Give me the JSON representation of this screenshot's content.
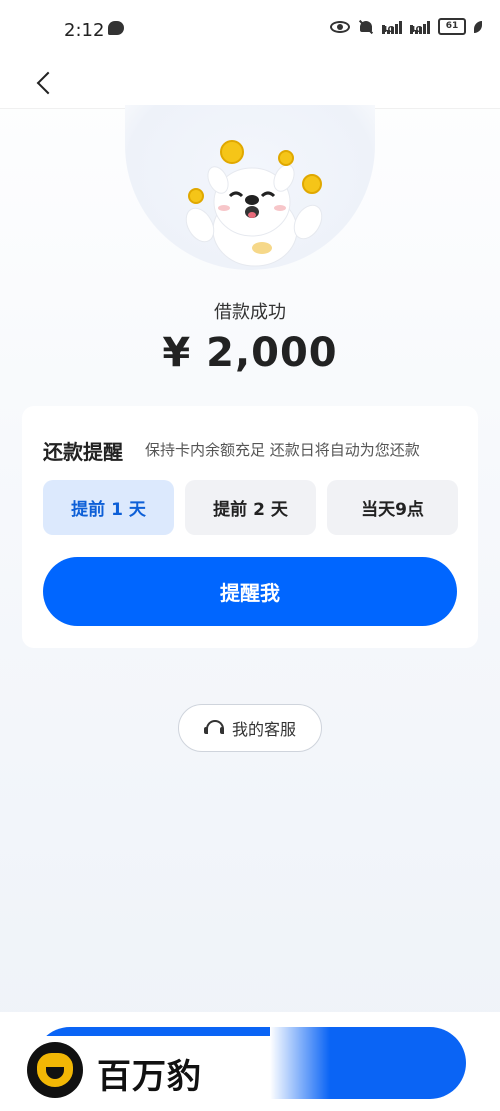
{
  "status_bar": {
    "time": "2:12",
    "battery": "61",
    "network_1": "4G",
    "network_2": "4G"
  },
  "result": {
    "title": "借款成功",
    "amount": "¥ 2,000"
  },
  "reminder_card": {
    "title": "还款提醒",
    "description": "保持卡内余额充足 还款日将自动为您还款",
    "options": [
      {
        "label": "提前 1 天",
        "selected": true
      },
      {
        "label": "提前 2 天",
        "selected": false
      },
      {
        "label": "当天9点",
        "selected": false
      }
    ],
    "remind_button": "提醒我"
  },
  "support": {
    "label": "我的客服"
  },
  "watermark": {
    "brand_name": "百万豹"
  },
  "colors": {
    "primary": "#0066ff",
    "selected_option_bg": "#dce9fd",
    "selected_option_text": "#0d5fd7"
  }
}
